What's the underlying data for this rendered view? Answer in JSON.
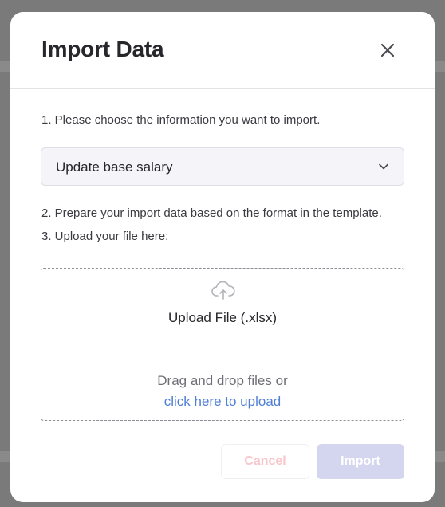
{
  "modal": {
    "title": "Import Data",
    "close_icon": "close-icon"
  },
  "steps": {
    "step1": "1. Please choose the information you want to import.",
    "step2": "2. Prepare your import data based on the format in the template.",
    "step3": "3. Upload your file here:"
  },
  "select": {
    "value": "Update base salary",
    "icon": "chevron-down-icon"
  },
  "dropzone": {
    "icon": "cloud-upload-icon",
    "title": "Upload File (.xlsx)",
    "drag_text": "Drag and drop files or",
    "link_text": "click here to upload"
  },
  "actions": {
    "cancel_label": "Cancel",
    "import_label": "Import"
  },
  "colors": {
    "link": "#4f7fd6",
    "import_disabled_bg": "#d4d5ee",
    "cancel_disabled_text": "#f7c7cc"
  }
}
